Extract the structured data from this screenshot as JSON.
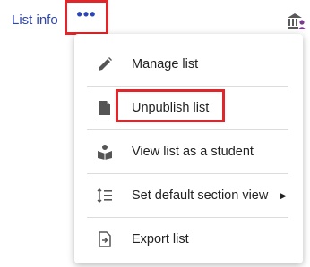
{
  "header": {
    "list_info_label": "List info",
    "more_button_label": "•••",
    "institution_icon": "institution-user-icon"
  },
  "menu": {
    "items": [
      {
        "label": "Manage list",
        "icon": "pencil-icon"
      },
      {
        "label": "Unpublish list",
        "icon": "document-icon",
        "highlighted": true
      },
      {
        "label": "View list as a student",
        "icon": "student-reading-icon"
      },
      {
        "label": "Set default section view",
        "icon": "sort-lines-icon",
        "has_submenu": true
      },
      {
        "label": "Export list",
        "icon": "export-file-icon"
      }
    ]
  },
  "colors": {
    "link_blue": "#2b45b6",
    "highlight_red": "#e0262a",
    "icon_gray": "#555555"
  }
}
